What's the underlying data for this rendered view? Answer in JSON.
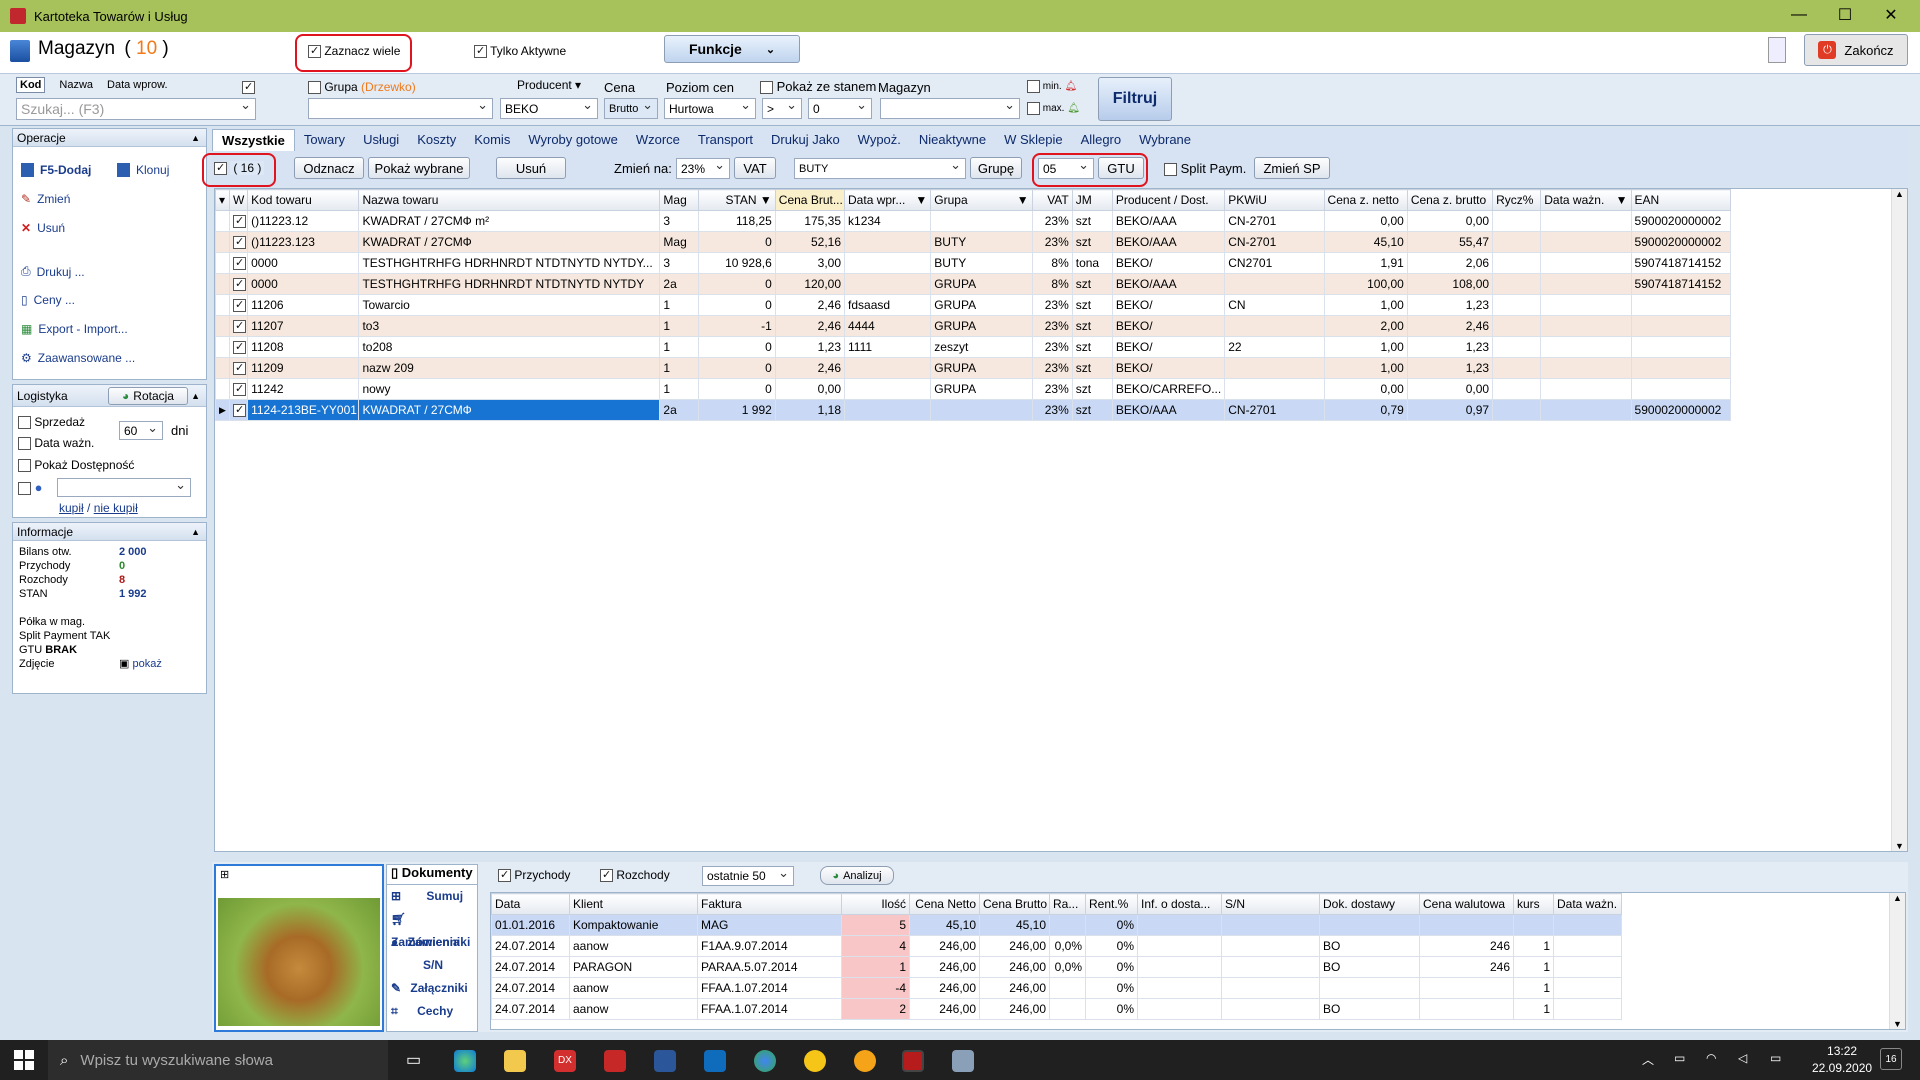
{
  "window": {
    "title": "Kartoteka Towarów i Usług"
  },
  "header": {
    "module": "Magazyn",
    "count": "10",
    "zaznacz_wiele": "Zaznacz wiele",
    "tylko_aktywne": "Tylko Aktywne",
    "funkcje": "Funkcje",
    "zakoncz": "Zakończ"
  },
  "filters": {
    "tabs": [
      "Kod",
      "Nazwa",
      "Data wprow."
    ],
    "search_placeholder": "Szukaj... (F3)",
    "grupa_label": "Grupa",
    "grupa_hint": "(Drzewko)",
    "producent_label": "Producent",
    "producent_value": "BEKO",
    "cena_label": "Cena",
    "cena_value": "Brutto",
    "poziom_label": "Poziom cen",
    "poziom_value": "Hurtowa",
    "pokaz_stan": "Pokaż ze stanem",
    "op_value": ">",
    "stan_value": "0",
    "magazyn_label": "Magazyn",
    "min_label": "min.",
    "max_label": "max.",
    "filtruj": "Filtruj"
  },
  "sidebar": {
    "operacje_title": "Operacje",
    "dodaj": "F5-Dodaj",
    "klonuj": "Klonuj",
    "zmien": "Zmień",
    "usun": "Usuń",
    "drukuj": "Drukuj ...",
    "ceny": "Ceny ...",
    "export": "Export - Import...",
    "zaawansowane": "Zaawansowane ...",
    "logistyka_title": "Logistyka",
    "rotacja": "Rotacja",
    "sprzedaz": "Sprzedaż",
    "data_wazn": "Data ważn.",
    "dni_value": "60",
    "dni": "dni",
    "pokaz_dostepnosc": "Pokaż Dostępność",
    "kupil": "kupił",
    "slash": "/",
    "nie_kupil": "nie kupił",
    "informacje_title": "Informacje",
    "info": [
      {
        "label": "Bilans otw.",
        "value": "2 000",
        "color": "#1a3c8c"
      },
      {
        "label": "Przychody",
        "value": "0",
        "color": "#2c8a2c"
      },
      {
        "label": "Rozchody",
        "value": "8",
        "color": "#b01818"
      },
      {
        "label": "STAN",
        "value": "1 992",
        "color": "#1a3c8c"
      }
    ],
    "polka": "Półka w mag.",
    "split_pay": "Split Payment TAK",
    "gtu_label": "GTU",
    "gtu_value": "BRAK",
    "zdjecie": "Zdjęcie",
    "pokaz": "pokaż"
  },
  "tabs": [
    "Wszystkie",
    "Towary",
    "Usługi",
    "Koszty",
    "Komis",
    "Wyroby gotowe",
    "Wzorce",
    "Transport",
    "Drukuj Jako",
    "Wypoż.",
    "Nieaktywne",
    "W Sklepie",
    "Allegro",
    "Wybrane"
  ],
  "toolbar": {
    "selected_count": "( 16 )",
    "odznacz": "Odznacz",
    "pokaz_wybrane": "Pokaż wybrane",
    "usun": "Usuń",
    "zmien_na": "Zmień na:",
    "vat_value": "23%",
    "vat_btn": "VAT",
    "grupa_value": "BUTY",
    "grupe_btn": "Grupę",
    "gtu_value": "05",
    "gtu_btn": "GTU",
    "split_paym": "Split Paym.",
    "zmien_sp": "Zmień SP"
  },
  "grid": {
    "columns": [
      "W",
      "Kod towaru",
      "Nazwa towaru",
      "Mag",
      "STAN",
      "Cena Brut...",
      "Data wpr...",
      "Grupa",
      "VAT",
      "JM",
      "Producent / Dost.",
      "PKWiU",
      "Cena z. netto",
      "Cena z. brutto",
      "Rycz%",
      "Data ważn.",
      "EAN"
    ],
    "rows": [
      [
        "()11223.12",
        "KWADRAT / 27СМФ  m²",
        "3",
        "118,25",
        "175,35",
        "k1234",
        "",
        "23%",
        "szt",
        "BEKO/AAA",
        "CN-2701",
        "0,00",
        "0,00",
        "",
        "",
        "5900020000002"
      ],
      [
        "()11223.123",
        "KWADRAT / 27СМФ",
        "Mag",
        "0",
        "52,16",
        "",
        "BUTY",
        "23%",
        "szt",
        "BEKO/AAA",
        "CN-2701",
        "45,10",
        "55,47",
        "",
        "",
        "5900020000002"
      ],
      [
        "0000",
        "TESTHGHTRHFG HDRHNRDT  NTDTNYTD NYTDY...",
        "3",
        "10 928,6",
        "3,00",
        "",
        "BUTY",
        "8%",
        "tona",
        "BEKO/",
        "CN2701",
        "1,91",
        "2,06",
        "",
        "",
        "5907418714152"
      ],
      [
        "0000",
        "TESTHGHTRHFG HDRHNRDT  NTDTNYTD NYTDY",
        "2a",
        "0",
        "120,00",
        "",
        "GRUPA",
        "8%",
        "szt",
        "BEKO/AAA",
        "",
        "100,00",
        "108,00",
        "",
        "",
        "5907418714152"
      ],
      [
        "11206",
        "Towarcio",
        "1",
        "0",
        "2,46",
        "fdsaasd",
        "GRUPA",
        "23%",
        "szt",
        "BEKO/",
        "CN",
        "1,00",
        "1,23",
        "",
        "",
        ""
      ],
      [
        "11207",
        "to3",
        "1",
        "-1",
        "2,46",
        "4444",
        "GRUPA",
        "23%",
        "szt",
        "BEKO/",
        "",
        "2,00",
        "2,46",
        "",
        "",
        ""
      ],
      [
        "11208",
        "to208",
        "1",
        "0",
        "1,23",
        "1111",
        "zeszyt",
        "23%",
        "szt",
        "BEKO/",
        "22",
        "1,00",
        "1,23",
        "",
        "",
        ""
      ],
      [
        "11209",
        "nazw 209",
        "1",
        "0",
        "2,46",
        "",
        "GRUPA",
        "23%",
        "szt",
        "BEKO/",
        "",
        "1,00",
        "1,23",
        "",
        "",
        ""
      ],
      [
        "11242",
        "nowy",
        "1",
        "0",
        "0,00",
        "",
        "GRUPA",
        "23%",
        "szt",
        "BEKO/CARREFO...",
        "",
        "0,00",
        "0,00",
        "",
        "",
        ""
      ],
      [
        "1124-213BE-YY001",
        "KWADRAT / 27СМФ",
        "2a",
        "1 992",
        "1,18",
        "",
        "",
        "23%",
        "szt",
        "BEKO/AAA",
        "CN-2701",
        "0,79",
        "0,97",
        "",
        "",
        "5900020000002"
      ]
    ]
  },
  "docs": {
    "menu": [
      "Dokumenty",
      "Sumuj",
      "Zamówienia",
      "Zamienniki",
      "S/N",
      "Załączniki",
      "Cechy"
    ],
    "przychody": "Przychody",
    "rozchody": "Rozchody",
    "ostatnie": "ostatnie 50",
    "analizuj": "Analizuj",
    "columns": [
      "Data",
      "Klient",
      "Faktura",
      "Ilość",
      "Cena Netto",
      "Cena Brutto",
      "Ra...",
      "Rent.%",
      "Inf. o dosta...",
      "S/N",
      "Dok. dostawy",
      "Cena walutowa",
      "kurs",
      "Data ważn."
    ],
    "rows": [
      [
        "01.01.2016",
        "Kompaktowanie",
        "MAG",
        "5",
        "45,10",
        "45,10",
        "",
        "0%",
        "",
        "",
        "",
        "",
        "",
        ""
      ],
      [
        "24.07.2014",
        "aanow",
        "F1AA.9.07.2014",
        "4",
        "246,00",
        "246,00",
        "0,0%",
        "0%",
        "",
        "",
        "BO",
        "246",
        "1",
        ""
      ],
      [
        "24.07.2014",
        "PARAGON",
        "PARAA.5.07.2014",
        "1",
        "246,00",
        "246,00",
        "0,0%",
        "0%",
        "",
        "",
        "BO",
        "246",
        "1",
        ""
      ],
      [
        "24.07.2014",
        "aanow",
        "FFAA.1.07.2014",
        "-4",
        "246,00",
        "246,00",
        "",
        "0%",
        "",
        "",
        "",
        "",
        "1",
        ""
      ],
      [
        "24.07.2014",
        "aanow",
        "FFAA.1.07.2014",
        "2",
        "246,00",
        "246,00",
        "",
        "0%",
        "",
        "",
        "BO",
        "",
        "1",
        ""
      ]
    ]
  },
  "taskbar": {
    "search_placeholder": "Wpisz tu wyszukiwane słowa",
    "time": "13:22",
    "date": "22.09.2020",
    "notif": "16"
  },
  "colors": {
    "titlebar": "#a8c25b",
    "accent": "#1874d2",
    "highlight_red": "#e0141e",
    "alt_row": "#f6e8de"
  }
}
